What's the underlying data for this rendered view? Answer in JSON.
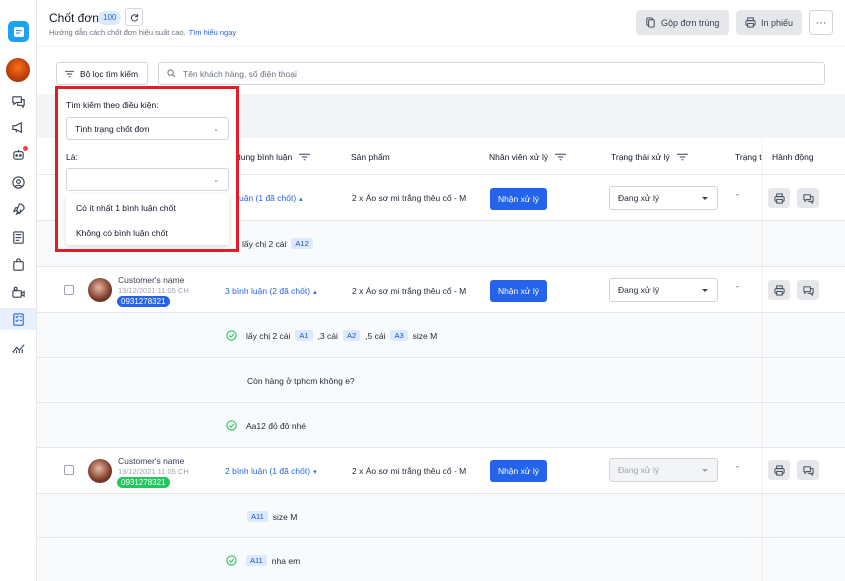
{
  "header": {
    "title": "Chốt đơn",
    "count": "100",
    "subtitle": "Hướng dẫn cách chốt đơn hiệu suất cao.",
    "learn_more": "Tìm hiểu ngay",
    "merge_label": "Gộp đơn trùng",
    "print_label": "In phiếu",
    "more_label": "···"
  },
  "filter": {
    "button_label": "Bộ lọc tìm kiếm",
    "search_placeholder": "Tên khách hàng, số điện thoại"
  },
  "popup": {
    "condition_label": "Tìm kiếm theo điều kiện:",
    "condition_value": "Tình trạng chốt đơn",
    "is_label": "Là:",
    "is_value": "",
    "options": [
      "Có ít nhất 1 bình luận chốt",
      "Không có bình luận chốt"
    ]
  },
  "table": {
    "columns": {
      "comment": "dung bình luận",
      "product": "Sản phẩm",
      "staff": "Nhân viên xử lý",
      "status": "Trạng thái xử lý",
      "state": "Trạng t",
      "action": "Hành động"
    },
    "rows": [
      {
        "comment_summary": "n luận (1 đã chốt)",
        "product": "2 x Áo sơ mi trắng thêu cổ - M",
        "assign": "Nhận xử lý",
        "status": "Đang xử lý",
        "state": "-",
        "lines": [
          {
            "text": "lấy chị 2 cái",
            "tag": "A12"
          }
        ]
      },
      {
        "customer_name": "Customer's name",
        "time": "13/12/2021 11:05 CH",
        "phone": "0931278321",
        "phone_color": "#2563eb",
        "comment_summary": "3 bình luận (2 đã chốt)",
        "product": "2 x Áo sơ mi trắng thêu cổ - M",
        "assign": "Nhận xử lý",
        "status": "Đang xử lý",
        "state": "-",
        "lines": [
          {
            "t1": "lấy chị 2 cái",
            "tag1": "A1",
            "t2": ",3 cái",
            "tag2": "A2",
            "t3": ",5 cái",
            "tag3": "A3",
            "t4": "size M"
          },
          {
            "text": "Còn hàng ở tphcm không e?"
          },
          {
            "text": "Aa12 đỏ đô nhé"
          }
        ]
      },
      {
        "customer_name": "Customer's name",
        "time": "13/12/2021 11:05 CH",
        "phone": "0931278321",
        "phone_color": "#22c55e",
        "comment_summary": "2 bình luận (1 đã chốt)",
        "product": "2 x Áo sơ mi trắng thêu cổ - M",
        "assign": "Nhận xử lý",
        "status": "Đang xử lý",
        "state": "-",
        "lines": [
          {
            "tag": "A11",
            "text": "size M"
          },
          {
            "tag": "A11",
            "text": "nha em"
          }
        ]
      }
    ]
  },
  "colors": {
    "accent": "#2563eb",
    "highlight_border": "#e11d28",
    "check_green": "#22c55e"
  }
}
